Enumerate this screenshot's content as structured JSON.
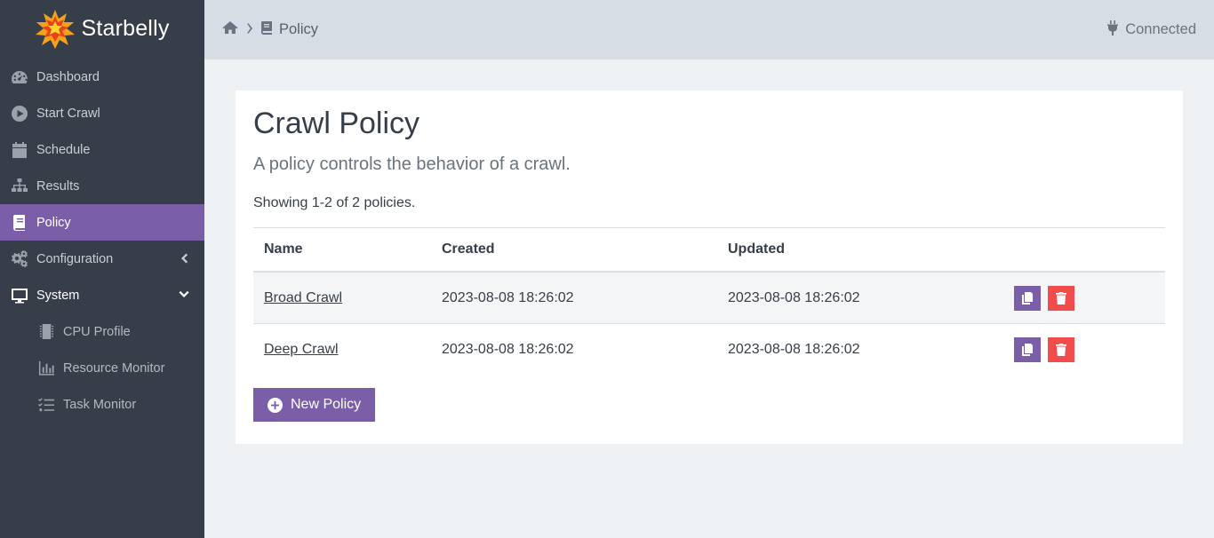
{
  "brand": {
    "name": "Starbelly",
    "logo_icon": "starburst-logo"
  },
  "colors": {
    "sidebar_bg": "#363f49",
    "accent": "#7a5fa8",
    "danger": "#f14b4b",
    "topbar_bg": "#d7dde4",
    "content_bg": "#eef1f4"
  },
  "sidebar": {
    "items": [
      {
        "label": "Dashboard",
        "icon": "dashboard-gauge-icon"
      },
      {
        "label": "Start Crawl",
        "icon": "play-circle-icon"
      },
      {
        "label": "Schedule",
        "icon": "calendar-icon"
      },
      {
        "label": "Results",
        "icon": "sitemap-icon"
      },
      {
        "label": "Policy",
        "icon": "book-icon",
        "active": true
      },
      {
        "label": "Configuration",
        "icon": "gears-icon",
        "expandable": true
      },
      {
        "label": "System",
        "icon": "desktop-icon",
        "expanded": true
      },
      {
        "label": "CPU Profile",
        "icon": "microchip-icon",
        "sub": true
      },
      {
        "label": "Resource Monitor",
        "icon": "bar-chart-icon",
        "sub": true
      },
      {
        "label": "Task Monitor",
        "icon": "tasks-icon",
        "sub": true
      }
    ]
  },
  "topbar": {
    "breadcrumb": {
      "home_icon": "home-icon",
      "current": "Policy",
      "current_icon": "book-icon"
    },
    "status": {
      "label": "Connected",
      "icon": "plug-icon"
    }
  },
  "main": {
    "title": "Crawl Policy",
    "subtitle": "A policy controls the behavior of a crawl.",
    "showing": "Showing 1-2 of 2 policies.",
    "table": {
      "headers": {
        "name": "Name",
        "created": "Created",
        "updated": "Updated"
      },
      "rows": [
        {
          "name": "Broad Crawl",
          "created": "2023-08-08 18:26:02",
          "updated": "2023-08-08 18:26:02"
        },
        {
          "name": "Deep Crawl",
          "created": "2023-08-08 18:26:02",
          "updated": "2023-08-08 18:26:02"
        }
      ]
    },
    "new_button_label": "New Policy"
  }
}
